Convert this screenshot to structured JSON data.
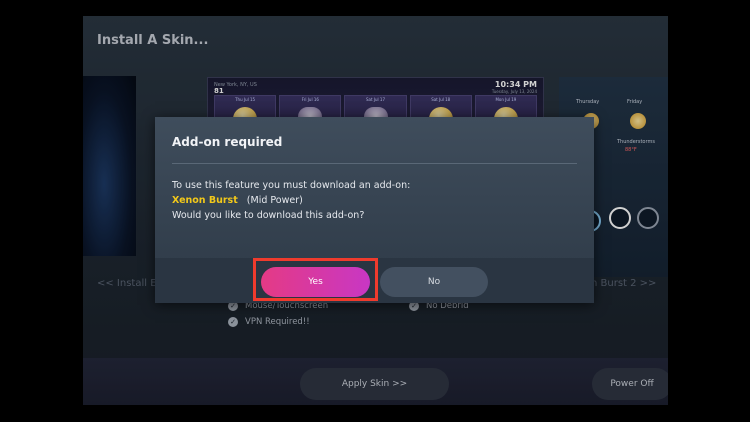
{
  "window": {
    "title": "Install A Skin..."
  },
  "carousel": {
    "center_preview": {
      "location_line": "New York, NY, US",
      "temperature": "81",
      "time": "10:34 PM",
      "date_line": "Tuesday, July 13, 2024",
      "days": [
        "Thu Jul 15",
        "Fri Jul 16",
        "Sat Jul 17",
        "Sat Jul 18",
        "Mon Jul 19"
      ]
    },
    "right_preview": {
      "day1": "Thursday",
      "day2": "Friday",
      "condition": "Thunderstorms",
      "temp": "88°F"
    },
    "nav_prev": "<< Install El",
    "nav_next": "n Burst 2 >>"
  },
  "features": {
    "left": [
      "Mouse/Touchscreen",
      "VPN Required!!"
    ],
    "right": [
      "No Debrid"
    ]
  },
  "bottom": {
    "apply_label": "Apply Skin >>",
    "power_label": "Power Off"
  },
  "dialog": {
    "title": "Add-on required",
    "line1": "To use this feature you must download an add-on:",
    "addon_name": "Xenon Burst",
    "addon_power": "(Mid Power)",
    "line3": "Would you like to download this add-on?",
    "yes_label": "Yes",
    "no_label": "No"
  },
  "colors": {
    "highlight": "#ef3b2d",
    "addon_name": "#f2c81a",
    "yes_gradient_start": "#e43a85",
    "yes_gradient_end": "#c837c4"
  }
}
